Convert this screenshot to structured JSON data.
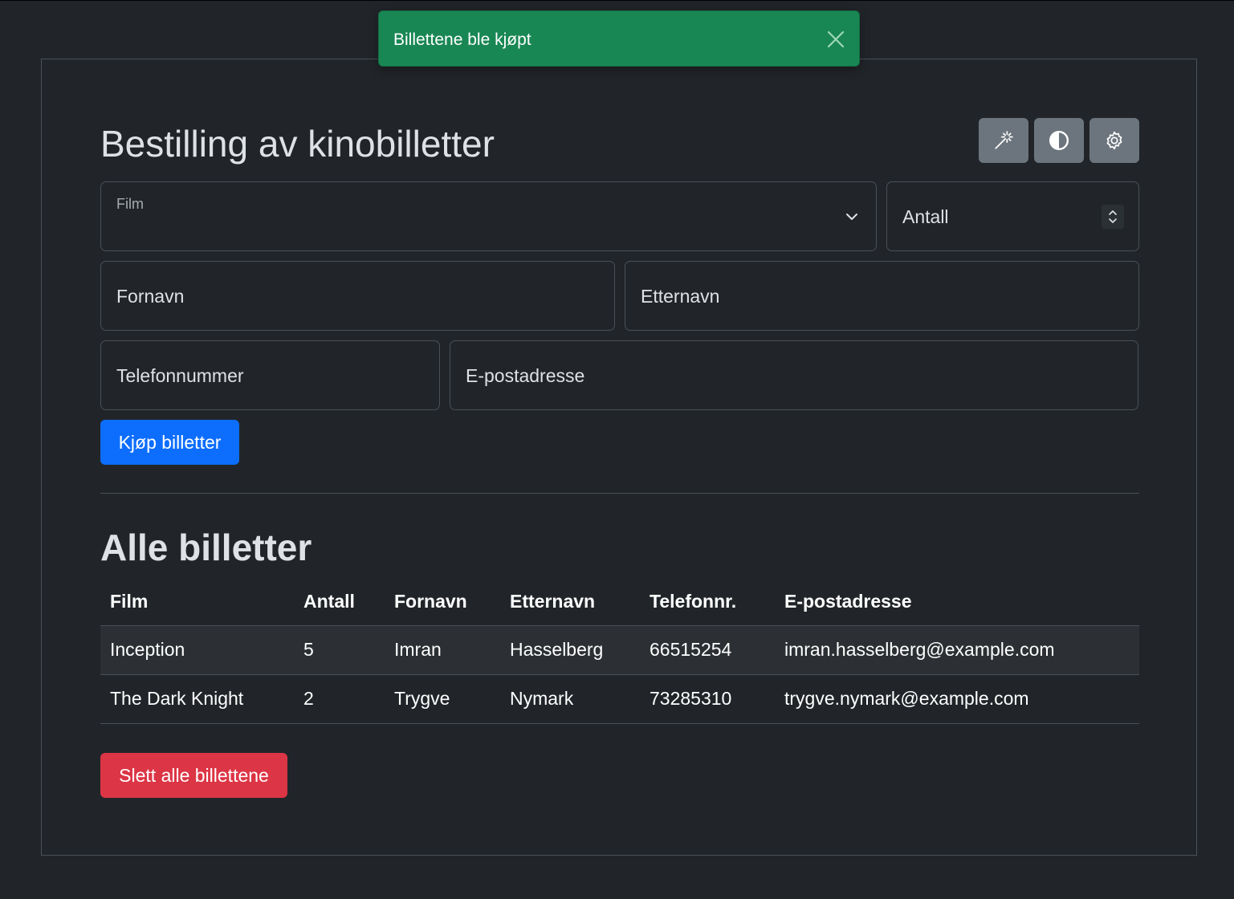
{
  "toast": {
    "message": "Billettene ble kjøpt",
    "color": "#198754"
  },
  "form": {
    "title": "Bestilling av kinobilletter",
    "toolbar": {
      "icons": [
        "magic-wand-icon",
        "contrast-icon",
        "gear-icon"
      ]
    },
    "film_label": "Film",
    "film_value": "",
    "antall_placeholder": "Antall",
    "fornavn_placeholder": "Fornavn",
    "etternavn_placeholder": "Etternavn",
    "telefon_placeholder": "Telefonnummer",
    "epost_placeholder": "E-postadresse",
    "submit_label": "Kjøp billetter"
  },
  "tickets": {
    "title": "Alle billetter",
    "columns": [
      "Film",
      "Antall",
      "Fornavn",
      "Etternavn",
      "Telefonnr.",
      "E-postadresse"
    ],
    "rows": [
      [
        "Inception",
        "5",
        "Imran",
        "Hasselberg",
        "66515254",
        "imran.hasselberg@example.com"
      ],
      [
        "The Dark Knight",
        "2",
        "Trygve",
        "Nymark",
        "73285310",
        "trygve.nymark@example.com"
      ]
    ],
    "delete_label": "Slett alle billettene"
  },
  "colors": {
    "primary": "#0d6efd",
    "danger": "#dc3545",
    "secondary": "#6c757d",
    "background": "#212529"
  }
}
